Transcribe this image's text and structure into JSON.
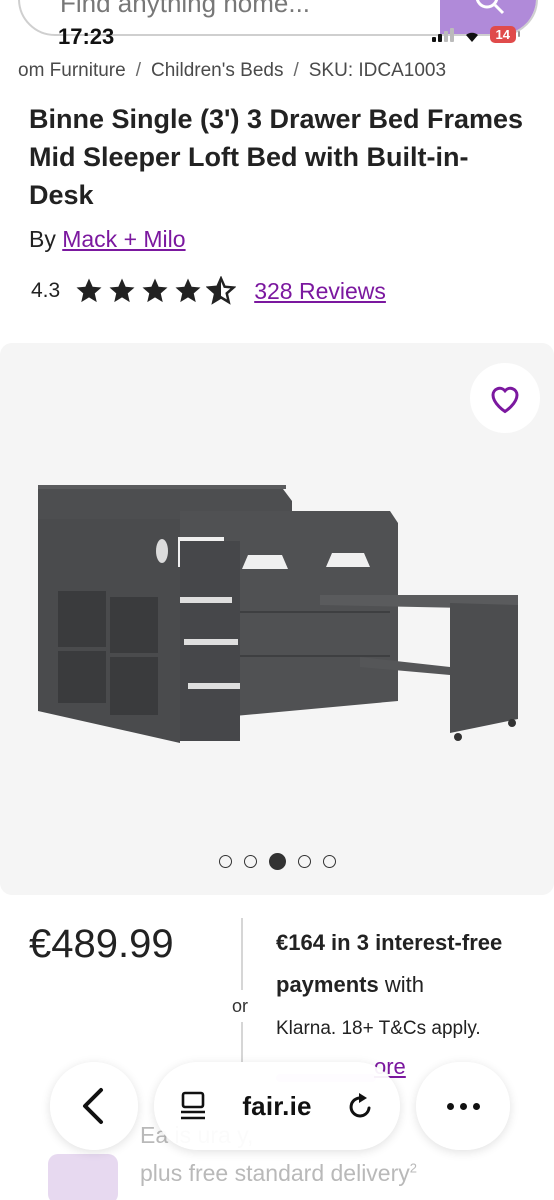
{
  "search": {
    "placeholder": "Find anything home..."
  },
  "status": {
    "time": "17:23",
    "battery": "14"
  },
  "breadcrumb": [
    "om Furniture",
    "Children's Beds",
    "SKU: IDCA1003"
  ],
  "product": {
    "title": "Binne Single (3') 3 Drawer Bed Frames Mid Sleeper Loft Bed with Built-in-Desk",
    "by_prefix": "By",
    "brand": "Mack + Milo",
    "rating": "4.3",
    "rating_value": 4.3,
    "reviews": "328 Reviews"
  },
  "gallery": {
    "dot_count": 5,
    "active_index": 2
  },
  "price": {
    "amount": "€489.99",
    "or": "or",
    "klarna_amount": "€164 in 3 interest-free payments",
    "klarna_with": "with",
    "klarna_terms": "Klarna. 18+ T&Cs apply.",
    "learn_more": "ore"
  },
  "delivery": {
    "line1": "Ea        is    ura       y,",
    "line2": "plus free standard delivery",
    "note": "2"
  },
  "browser": {
    "url": "fair.ie"
  },
  "colors": {
    "accent": "#7b189f",
    "star": "#222222",
    "search_button": "#b08ad9",
    "battery": "#e04b4b"
  },
  "icons": [
    "search-icon",
    "signal-icon",
    "wifi-icon",
    "battery-icon",
    "star-icon",
    "star-half-icon",
    "heart-icon",
    "chevron-left-icon",
    "reader-icon",
    "reload-icon",
    "more-icon"
  ]
}
